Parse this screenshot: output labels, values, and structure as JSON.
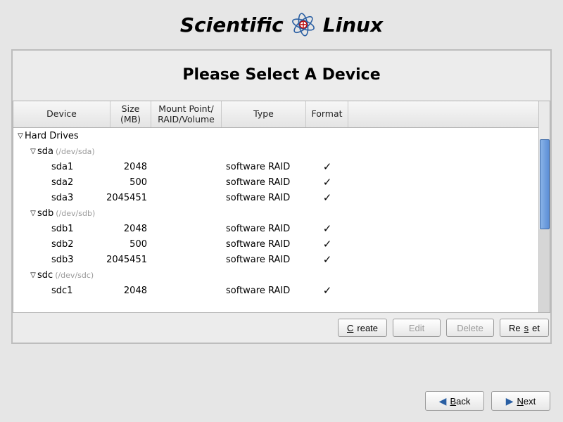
{
  "logo": {
    "word1": "Scientific",
    "word2": "Linux"
  },
  "panel_title": "Please Select A Device",
  "columns": {
    "device": "Device",
    "size": "Size\n(MB)",
    "mount": "Mount Point/\nRAID/Volume",
    "type": "Type",
    "format": "Format"
  },
  "tree": {
    "root_label": "Hard Drives",
    "drives": [
      {
        "name": "sda",
        "path": "(/dev/sda)",
        "parts": [
          {
            "name": "sda1",
            "size": "2048",
            "type": "software RAID",
            "format": true
          },
          {
            "name": "sda2",
            "size": "500",
            "type": "software RAID",
            "format": true
          },
          {
            "name": "sda3",
            "size": "2045451",
            "type": "software RAID",
            "format": true
          }
        ]
      },
      {
        "name": "sdb",
        "path": "(/dev/sdb)",
        "parts": [
          {
            "name": "sdb1",
            "size": "2048",
            "type": "software RAID",
            "format": true
          },
          {
            "name": "sdb2",
            "size": "500",
            "type": "software RAID",
            "format": true
          },
          {
            "name": "sdb3",
            "size": "2045451",
            "type": "software RAID",
            "format": true
          }
        ]
      },
      {
        "name": "sdc",
        "path": "(/dev/sdc)",
        "parts": [
          {
            "name": "sdc1",
            "size": "2048",
            "type": "software RAID",
            "format": true
          }
        ]
      }
    ]
  },
  "buttons": {
    "create": "Create",
    "edit": "Edit",
    "delete": "Delete",
    "reset": "Reset",
    "back": "Back",
    "next": "Next"
  }
}
